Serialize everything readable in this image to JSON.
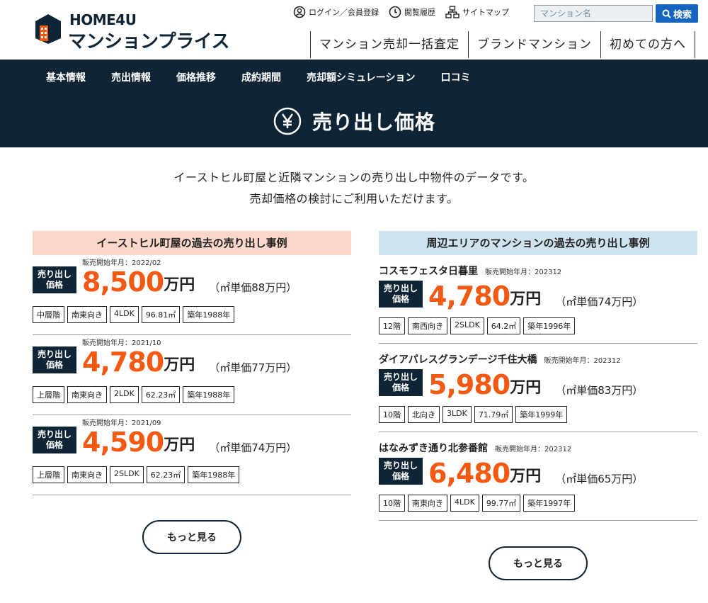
{
  "header": {
    "logo_line1": "HOME4U",
    "logo_line2": "マンションプライス",
    "toplinks": [
      {
        "label": "ログイン／会員登録",
        "icon": "user-circle-icon"
      },
      {
        "label": "閲覧履歴",
        "icon": "clock-icon"
      },
      {
        "label": "サイトマップ",
        "icon": "sitemap-icon"
      }
    ],
    "search_placeholder": "マンション名",
    "search_button": "検索",
    "nav": [
      "マンション売却一括査定",
      "ブランドマンション",
      "初めての方へ"
    ]
  },
  "subnav": [
    "基本情報",
    "売出情報",
    "価格推移",
    "成約期間",
    "売却額シミュレーション",
    "口コミ"
  ],
  "hero": {
    "title": "売り出し価格",
    "icon": "yen-circle-icon"
  },
  "intro": {
    "line1": "イーストヒル町屋と近隣マンションの売り出し中物件のデータです。",
    "line2": "売却価格の検討にご利用いただけます。"
  },
  "left": {
    "title": "イーストヒル町屋の過去の売り出し事例",
    "entries": [
      {
        "date": "販売開始年月：2022/02",
        "badge1": "売り出し",
        "badge2": "価格",
        "price": "8,500",
        "unit": "万円",
        "unit_price": "（㎡単価88万円）",
        "tags": [
          "中層階",
          "南東向き",
          "4LDK",
          "96.81㎡",
          "築年1988年"
        ]
      },
      {
        "date": "販売開始年月：2021/10",
        "badge1": "売り出し",
        "badge2": "価格",
        "price": "4,780",
        "unit": "万円",
        "unit_price": "（㎡単価77万円）",
        "tags": [
          "上層階",
          "南東向き",
          "2LDK",
          "62.23㎡",
          "築年1988年"
        ]
      },
      {
        "date": "販売開始年月：2021/09",
        "badge1": "売り出し",
        "badge2": "価格",
        "price": "4,590",
        "unit": "万円",
        "unit_price": "（㎡単価74万円）",
        "tags": [
          "上層階",
          "南東向き",
          "2SLDK",
          "62.23㎡",
          "築年1988年"
        ]
      }
    ],
    "more": "もっと見る"
  },
  "right": {
    "title": "周辺エリアのマンションの過去の売り出し事例",
    "entries": [
      {
        "name": "コスモフェスタ日暮里",
        "date": "販売開始年月：202312",
        "badge1": "売り出し",
        "badge2": "価格",
        "price": "4,780",
        "unit": "万円",
        "unit_price": "（㎡単価74万円）",
        "tags": [
          "12階",
          "南西向き",
          "2SLDK",
          "64.2㎡",
          "築年1996年"
        ]
      },
      {
        "name": "ダイアパレスグランデージ千住大橋",
        "date": "販売開始年月：202312",
        "badge1": "売り出し",
        "badge2": "価格",
        "price": "5,980",
        "unit": "万円",
        "unit_price": "（㎡単価83万円）",
        "tags": [
          "10階",
          "北向き",
          "3LDK",
          "71.79㎡",
          "築年1999年"
        ]
      },
      {
        "name": "はなみずき通り北参番館",
        "date": "販売開始年月：202312",
        "badge1": "売り出し",
        "badge2": "価格",
        "price": "6,480",
        "unit": "万円",
        "unit_price": "（㎡単価65万円）",
        "tags": [
          "10階",
          "南東向き",
          "4LDK",
          "99.77㎡",
          "築年1997年"
        ]
      }
    ],
    "more": "もっと見る"
  },
  "colors": {
    "navy": "#0f2535",
    "orange": "#f25a14",
    "blue": "#1464c0",
    "pink": "#fbd7ca",
    "lightblue": "#cfe3ef"
  }
}
